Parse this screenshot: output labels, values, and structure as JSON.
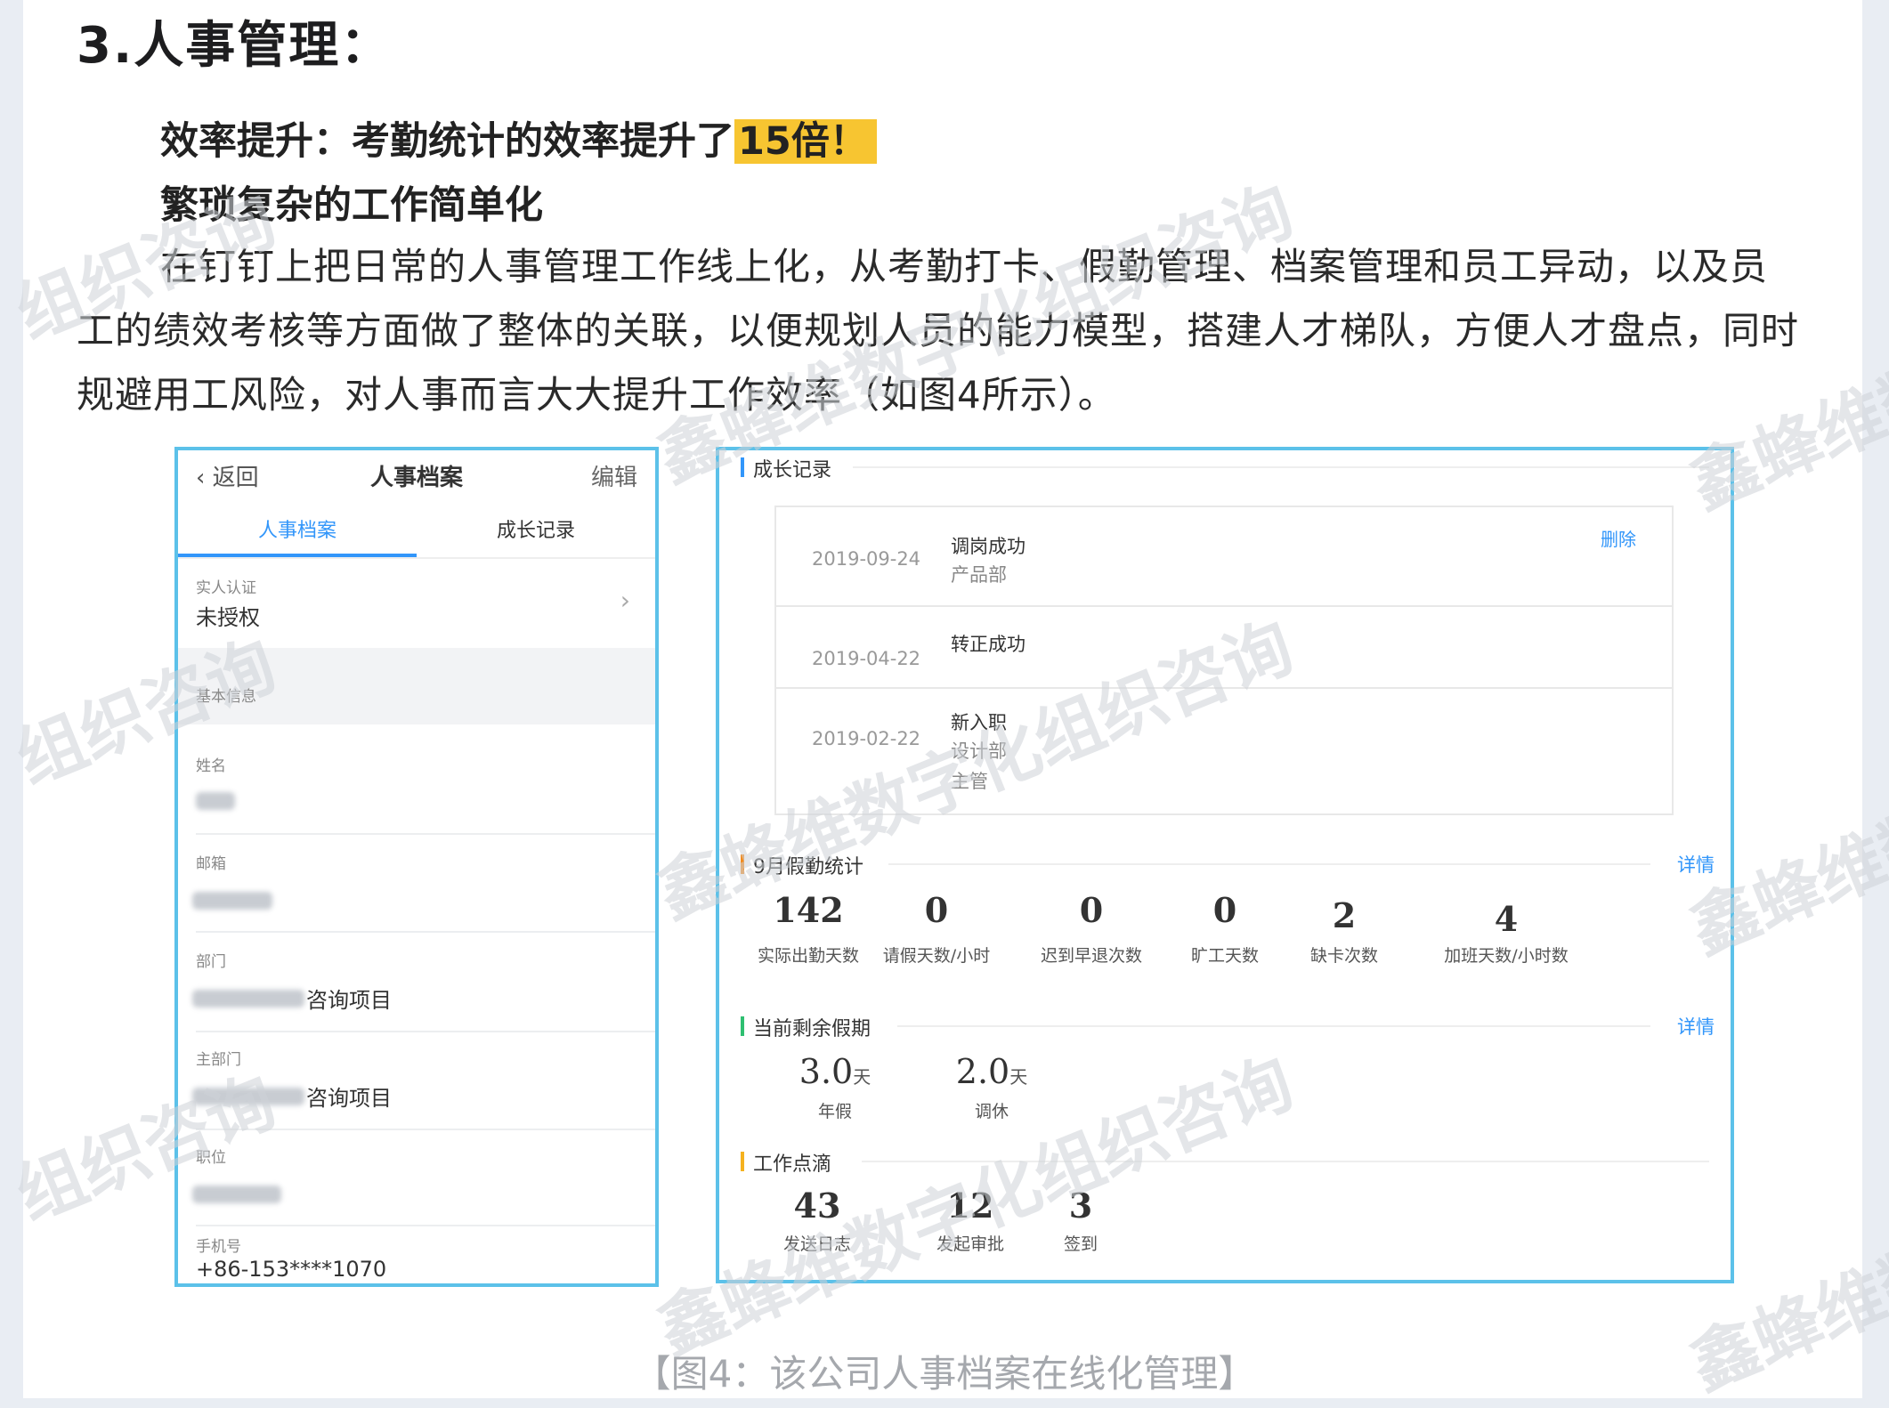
{
  "heading": "3.人事管理：",
  "lead": {
    "prefix": "效率提升：考勤统计的效率提升了",
    "highlight": "15倍！",
    "line2": "繁琐复杂的工作简单化"
  },
  "paragraph": "在钉钉上把日常的人事管理工作线上化，从考勤打卡、假勤管理、档案管理和员工异动，以及员工的绩效考核等方面做了整体的关联，以便规划人员的能力模型，搭建人才梯队，方便人才盘点，同时规避用工风险，对人事而言大大提升工作效率（如图4所示）。",
  "caption": "【图4：该公司人事档案在线化管理】",
  "phone": {
    "back": "返回",
    "title": "人事档案",
    "edit": "编辑",
    "tabs": [
      "人事档案",
      "成长记录"
    ],
    "realname_label": "实人认证",
    "realname_value": "未授权",
    "section": "基本信息",
    "fields": [
      {
        "label": "姓名",
        "value": ""
      },
      {
        "label": "邮箱",
        "value": ""
      },
      {
        "label": "部门",
        "value": "咨询项目"
      },
      {
        "label": "主部门",
        "value": "咨询项目"
      },
      {
        "label": "职位",
        "value": ""
      },
      {
        "label": "手机号",
        "value": "+86-153****1070"
      }
    ]
  },
  "desk": {
    "growth_title": "成长记录",
    "growth_items": [
      {
        "date": "2019-09-24",
        "line1": "调岗成功",
        "line2": "产品部",
        "line3": "",
        "action": "删除"
      },
      {
        "date": "2019-04-22",
        "line1": "转正成功",
        "line2": "",
        "line3": "",
        "action": ""
      },
      {
        "date": "2019-02-22",
        "line1": "新入职",
        "line2": "设计部",
        "line3": "主管",
        "action": ""
      }
    ],
    "leave_title": "9月假勤统计",
    "leave_link": "详情",
    "leave_stats": [
      {
        "num": "142",
        "label": "实际出勤天数"
      },
      {
        "num": "0",
        "label": "请假天数/小时"
      },
      {
        "num": "0",
        "label": "迟到早退次数"
      },
      {
        "num": "0",
        "label": "旷工天数"
      },
      {
        "num": "2",
        "label": "缺卡次数"
      },
      {
        "num": "4",
        "label": "加班天数/小时数"
      }
    ],
    "holiday_title": "当前剩余假期",
    "holiday_link": "详情",
    "holidays": [
      {
        "num": "3.0",
        "unit": "天",
        "label": "年假"
      },
      {
        "num": "2.0",
        "unit": "天",
        "label": "调休"
      }
    ],
    "work_title": "工作点滴",
    "work_stats": [
      {
        "num": "43",
        "label": "发送日志"
      },
      {
        "num": "12",
        "label": "发起审批"
      },
      {
        "num": "3",
        "label": "签到"
      }
    ]
  },
  "watermarks": [
    "鑫蜂维数字化组织咨询",
    "组织咨询",
    "鑫蜂维数"
  ]
}
